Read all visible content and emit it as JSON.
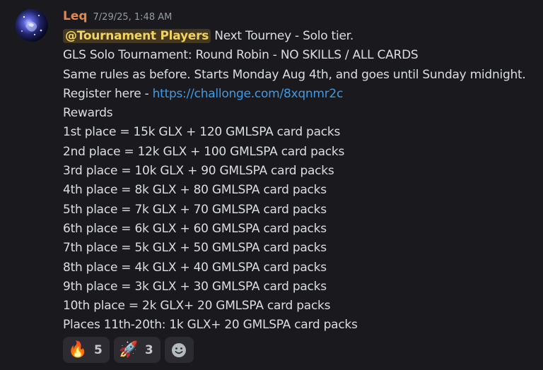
{
  "message": {
    "author": "Leq",
    "timestamp": "7/29/25, 1:48 AM",
    "author_color": "#e3884c",
    "avatar_icon": "night-sky-avatar",
    "mention": "@Tournament Players",
    "line1_rest": " Next Tourney - Solo tier.",
    "line2": "GLS Solo Tournament: Round Robin - NO SKILLS / ALL CARDS",
    "line3": "Same rules as before. Starts Monday Aug 4th, and goes until Sunday midnight.",
    "register_prefix": "Register here - ",
    "register_link": "https://challonge.com/8xqnmr2c",
    "rewards_heading": "Rewards",
    "rewards": [
      "1st place = 15k GLX + 120 GMLSPA card packs",
      "2nd place = 12k GLX + 100 GMLSPA card packs",
      "3rd place = 10k GLX + 90 GMLSPA card packs",
      "4th place = 8k GLX + 80 GMLSPA card packs",
      "5th place = 7k GLX + 70 GMLSPA card packs",
      "6th place = 6k GLX + 60 GMLSPA card packs",
      "7th place = 5k GLX + 50 GMLSPA card packs",
      "8th place = 4k GLX + 40 GMLSPA card packs",
      "9th place = 3k GLX + 30 GMLSPA card packs",
      "10th place = 2k GLX+ 20 GMLSPA card packs",
      "Places 11th-20th: 1k GLX+ 20 GMLSPA card packs"
    ]
  },
  "reactions": [
    {
      "emoji": "🔥",
      "icon": "fire-icon",
      "count": "5"
    },
    {
      "emoji": "🚀",
      "icon": "rocket-icon",
      "count": "3"
    }
  ],
  "add_reaction_icon": "smiley-add-icon",
  "colors": {
    "background": "#1a1a1e",
    "text": "#dbdee1",
    "link": "#3f9ae6",
    "mention_text": "#f2d45c",
    "timestamp": "#949ba4",
    "reaction_bg": "#2b2b31"
  }
}
